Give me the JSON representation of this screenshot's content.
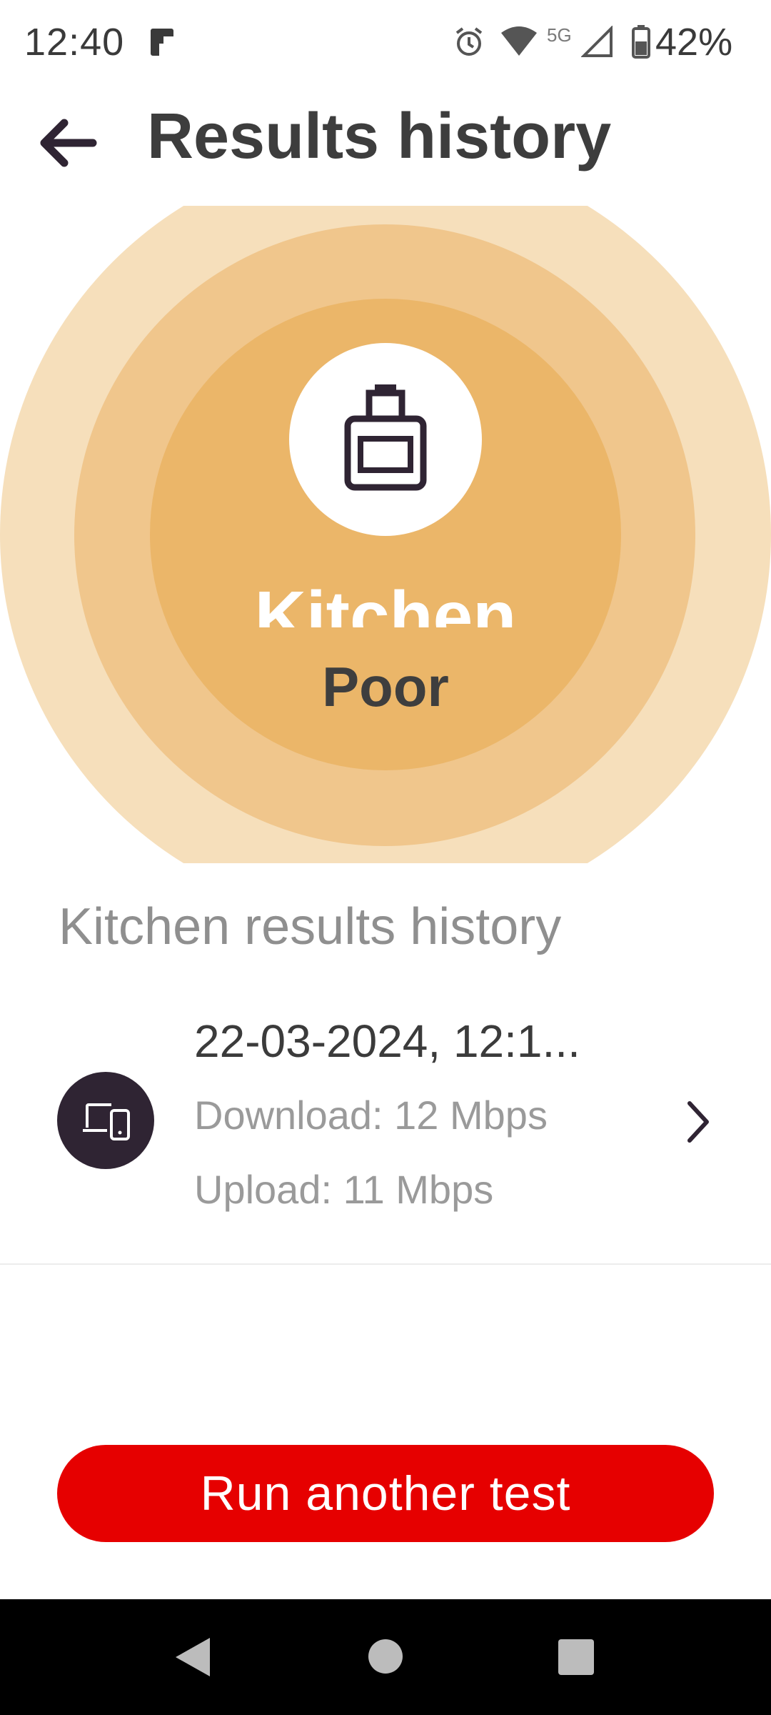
{
  "status_bar": {
    "time": "12:40",
    "network_label": "5G",
    "battery": "42%"
  },
  "header": {
    "title": "Results history",
    "back_icon": "arrow-left-icon"
  },
  "hero": {
    "room_name": "Kitchen",
    "quality": "Poor",
    "room_icon": "oven-icon",
    "colors": {
      "ring_outer": "#f6dfbb",
      "ring_middle": "#f0c68c",
      "ring_inner": "#ebb669"
    }
  },
  "history": {
    "section_title": "Kitchen results history",
    "items": [
      {
        "date": "22-03-2024, 12:1...",
        "download": "Download: 12 Mbps",
        "upload": "Upload: 11 Mbps",
        "icon": "devices-icon"
      }
    ]
  },
  "actions": {
    "run_test_label": "Run another test",
    "accent": "#e60000"
  }
}
